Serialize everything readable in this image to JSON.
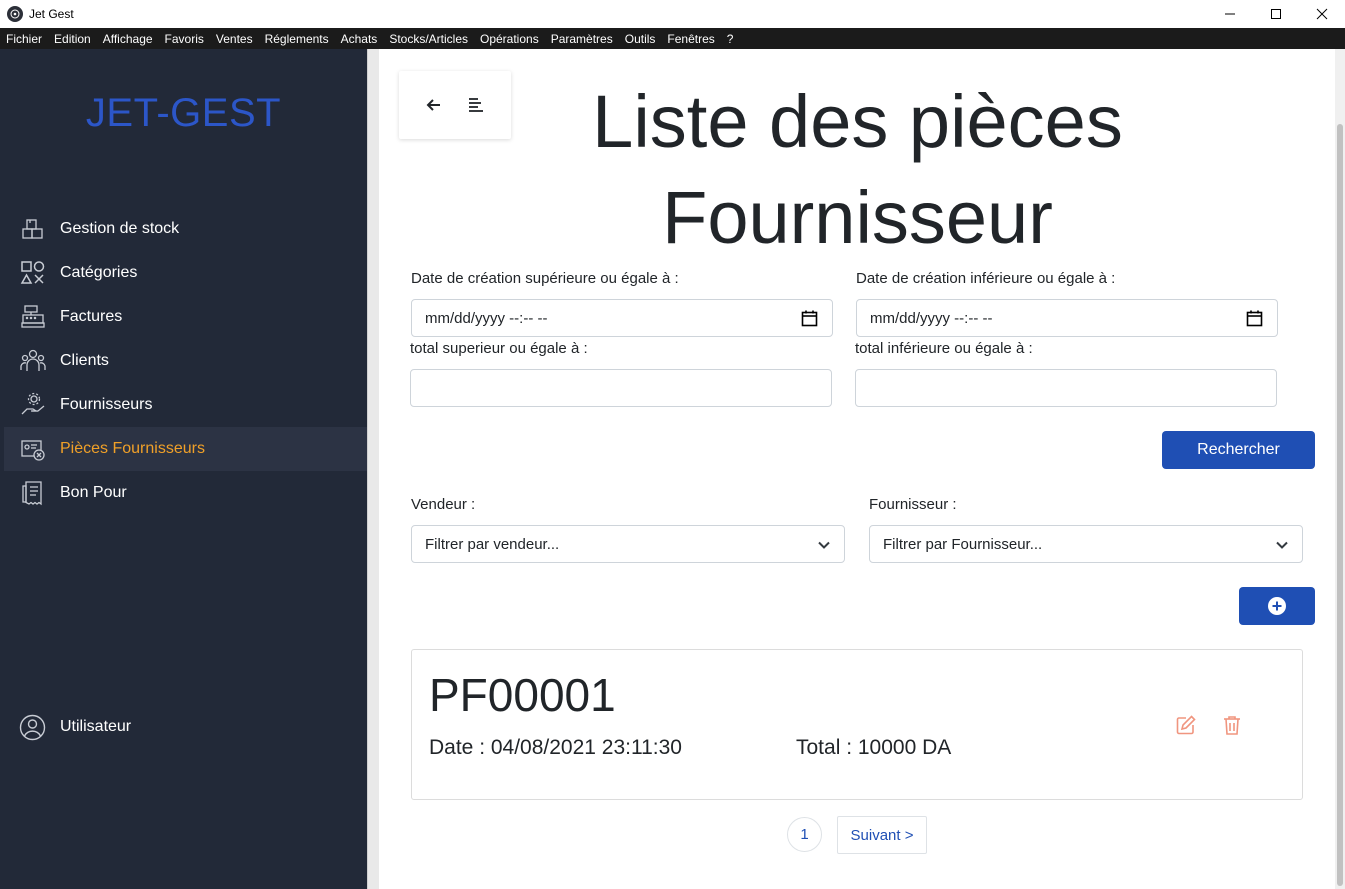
{
  "window": {
    "title": "Jet Gest"
  },
  "menubar": {
    "items": [
      "Fichier",
      "Edition",
      "Affichage",
      "Favoris",
      "Ventes",
      "Réglements",
      "Achats",
      "Stocks/Articles",
      "Opérations",
      "Paramètres",
      "Outils",
      "Fenêtres",
      "?"
    ]
  },
  "sidebar": {
    "brand": "JET-GEST",
    "items": [
      {
        "label": "Gestion de stock",
        "icon": "boxes-icon"
      },
      {
        "label": "Catégories",
        "icon": "shapes-icon"
      },
      {
        "label": "Factures",
        "icon": "cash-register-icon"
      },
      {
        "label": "Clients",
        "icon": "users-icon"
      },
      {
        "label": "Fournisseurs",
        "icon": "supplier-hand-icon"
      },
      {
        "label": "Pièces Fournisseurs",
        "icon": "supplier-document-icon",
        "active": true
      },
      {
        "label": "Bon Pour",
        "icon": "receipt-icon"
      }
    ],
    "user": {
      "label": "Utilisateur",
      "icon": "user-circle-icon"
    }
  },
  "main": {
    "title": "Liste des pièces Fournisseur",
    "filters": {
      "date_from_label": "Date de création supérieure ou égale à :",
      "date_from_value": "mm/dd/yyyy --:-- --",
      "date_to_label": "Date de création inférieure ou égale à :",
      "date_to_value": "mm/dd/yyyy --:-- --",
      "total_min_label": "total superieur ou égale à :",
      "total_min_value": "",
      "total_max_label": "total inférieure ou égale à :",
      "total_max_value": "",
      "search_button": "Rechercher",
      "vendor_label": "Vendeur :",
      "vendor_value": "Filtrer par vendeur...",
      "supplier_label": "Fournisseur :",
      "supplier_value": "Filtrer par Fournisseur..."
    },
    "pieces": [
      {
        "code": "PF00001",
        "date": "Date : 04/08/2021 23:11:30",
        "total": "Total : 10000 DA"
      }
    ],
    "pagination": {
      "current_page": "1",
      "next_label": "Suivant >"
    }
  },
  "colors": {
    "sidebar_bg": "#222938",
    "brand": "#2c56c8",
    "active": "#f0a028",
    "primary": "#1f4fb4",
    "action_icon": "#f0957f"
  }
}
